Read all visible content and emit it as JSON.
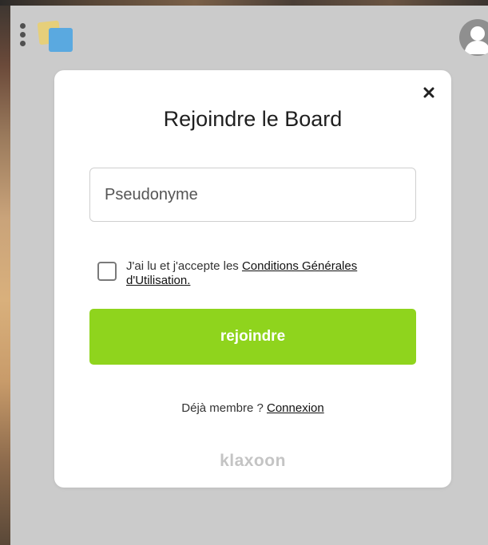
{
  "modal": {
    "title": "Rejoindre le Board",
    "nickname_placeholder": "Pseudonyme",
    "nickname_value": "",
    "terms_prefix": "J'ai lu et j'accepte les ",
    "terms_link": "Conditions Générales d'Utilisation.",
    "terms_checked": false,
    "join_label": "rejoindre",
    "already_member": "Déjà membre ? ",
    "login_link": "Connexion",
    "brand": "klaxoon"
  },
  "icons": {
    "menu": "vertical-dots-icon",
    "logo": "stacked-notes-logo",
    "avatar": "user-avatar-icon",
    "close": "close-icon"
  },
  "colors": {
    "background": "#cbcbcb",
    "modal": "#ffffff",
    "join_button": "#8fd41d",
    "brand_text": "#c4c4c4",
    "logo_yellow": "#e6cf7a",
    "logo_blue": "#5aa9e0"
  }
}
